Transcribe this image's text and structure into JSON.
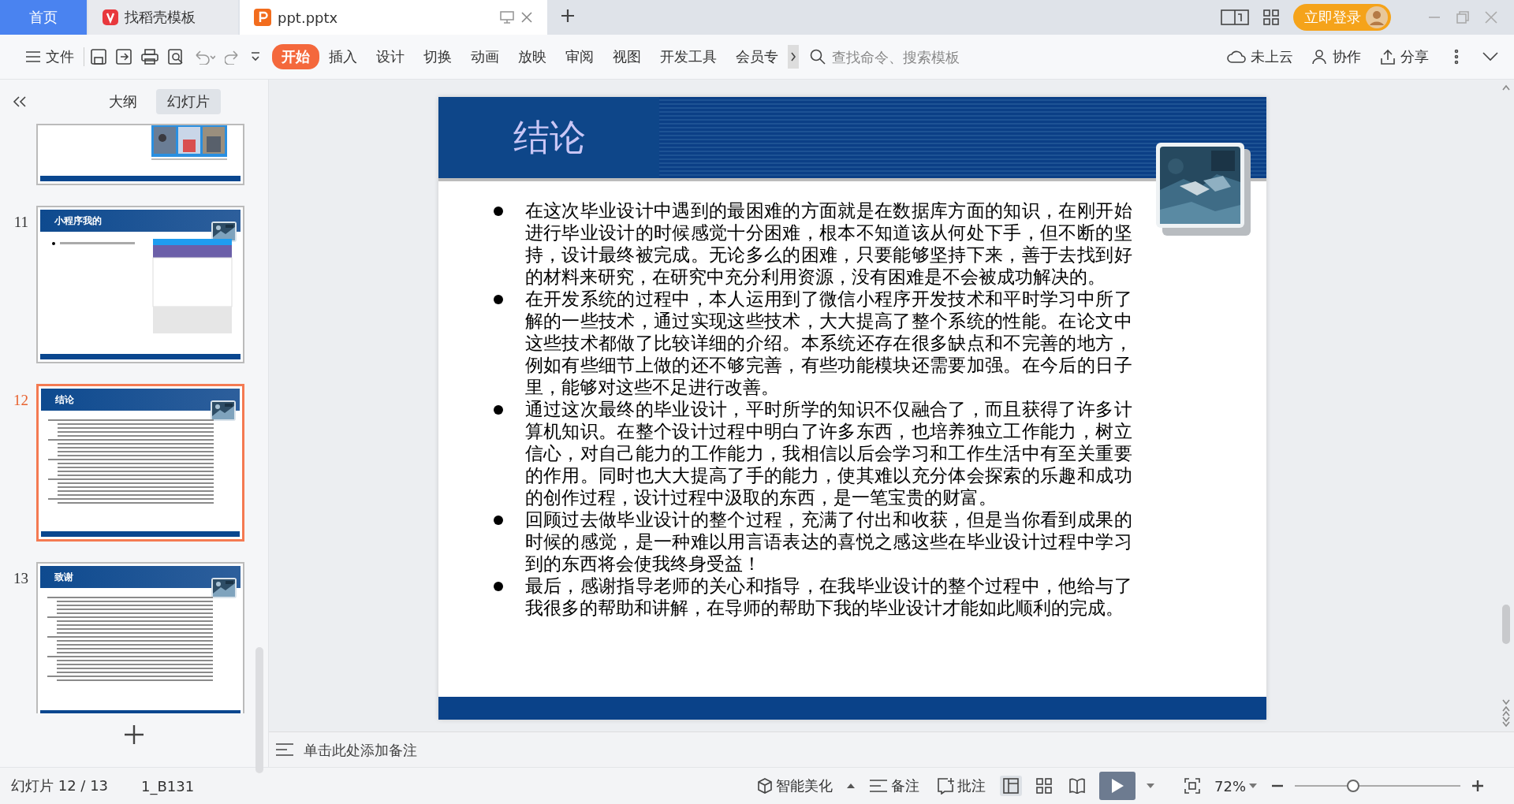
{
  "tabs": [
    {
      "label": "首页",
      "kind": "home",
      "selected": false
    },
    {
      "label": "找稻壳模板",
      "kind": "docer",
      "selected": false
    },
    {
      "label": "ppt.pptx",
      "kind": "doc",
      "selected": true
    }
  ],
  "login_button": "立即登录",
  "toolbar": {
    "file_menu": "文件",
    "ribbon_tabs": [
      {
        "label": "开始",
        "selected": true
      },
      {
        "label": "插入",
        "selected": false
      },
      {
        "label": "设计",
        "selected": false
      },
      {
        "label": "切换",
        "selected": false
      },
      {
        "label": "动画",
        "selected": false
      },
      {
        "label": "放映",
        "selected": false
      },
      {
        "label": "审阅",
        "selected": false
      },
      {
        "label": "视图",
        "selected": false
      },
      {
        "label": "开发工具",
        "selected": false
      },
      {
        "label": "会员专",
        "selected": false
      }
    ],
    "search": {
      "placeholder": "查找命令、搜索模板"
    },
    "cloud": "未上云",
    "collaborate": "协作",
    "share": "分享"
  },
  "side_panel": {
    "tabs": [
      {
        "label": "大纲",
        "selected": false
      },
      {
        "label": "幻灯片",
        "selected": true
      }
    ],
    "slides": [
      {
        "kind": "screens",
        "selected": false
      },
      {
        "kind": "phone",
        "number": "11",
        "title": "小程序我的",
        "selected": false
      },
      {
        "kind": "text",
        "number": "12",
        "title": "结论",
        "selected": true
      },
      {
        "kind": "text",
        "number": "13",
        "title": "致谢",
        "selected": false
      }
    ]
  },
  "slide": {
    "title": "结论",
    "bullets": [
      "在这次毕业设计中遇到的最困难的方面就是在数据库方面的知识，在刚开始进行毕业设计的时候感觉十分困难，根本不知道该从何处下手，但不断的坚持，设计最终被完成。无论多么的困难，只要能够坚持下来，善于去找到好的材料来研究，在研究中充分利用资源，没有困难是不会被成功解决的。",
      "在开发系统的过程中，本人运用到了微信小程序开发技术和平时学习中所了解的一些技术，通过实现这些技术，大大提高了整个系统的性能。在论文中这些技术都做了比较详细的介绍。本系统还存在很多缺点和不完善的地方，例如有些细节上做的还不够完善，有些功能模块还需要加强。在今后的日子里，能够对这些不足进行改善。",
      "通过这次最终的毕业设计，平时所学的知识不仅融合了，而且获得了许多计算机知识。在整个设计过程中明白了许多东西，也培养独立工作能力，树立信心，对自己能力的工作能力，我相信以后会学习和工作生活中有至关重要的作用。同时也大大提高了手的能力，使其难以充分体会探索的乐趣和成功的创作过程，设计过程中汲取的东西，是一笔宝贵的财富。",
      "回顾过去做毕业设计的整个过程，充满了付出和收获，但是当你看到成果的时候的感觉，是一种难以用言语表达的喜悦之感这些在毕业设计过程中学习到的东西将会使我终身受益！",
      "最后，感谢指导老师的关心和指导，在我毕业设计的整个过程中，他给与了我很多的帮助和讲解，在导师的帮助下我的毕业设计才能如此顺利的完成。"
    ]
  },
  "notes": {
    "placeholder": "单击此处添加备注"
  },
  "status_bar": {
    "slide_indicator": "幻灯片 12 / 13",
    "template": "1_B131",
    "beautify": "智能美化",
    "notes": "备注",
    "comment": "批注",
    "views": [
      {
        "kind": "normal",
        "selected": true
      },
      {
        "kind": "sorter",
        "selected": false
      },
      {
        "kind": "reading",
        "selected": false
      }
    ],
    "zoom": "72%",
    "zoom_slider": {
      "level": 0.35
    }
  }
}
